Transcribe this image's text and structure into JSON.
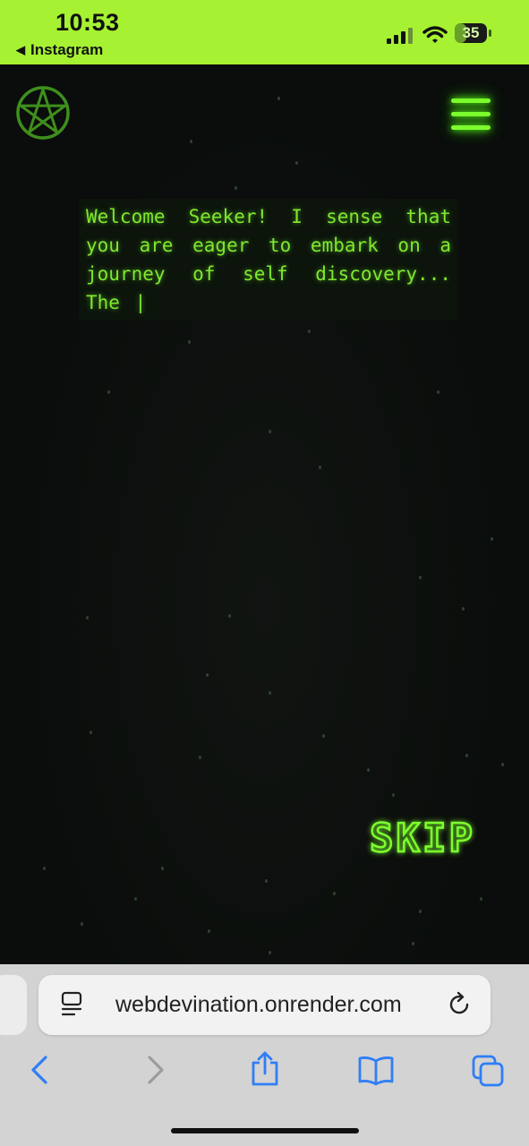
{
  "status_bar": {
    "time": "10:53",
    "back_app": "Instagram",
    "battery": "35",
    "battery_level": 0.35,
    "accent_color": "#a6f232"
  },
  "page": {
    "logo_icon": "pentagram-icon",
    "menu_icon": "hamburger-menu-icon",
    "intro_text": "Welcome Seeker! I sense that you are eager to embark on a journey of self discovery... The",
    "cursor": "|",
    "skip_label": "SKIP",
    "glow_color": "#7dff2e"
  },
  "browser": {
    "url": "webdevination.onrender.com",
    "icons": [
      "page-settings-icon",
      "reload-icon",
      "back-arrow-icon",
      "forward-arrow-icon",
      "share-icon",
      "bookmarks-icon",
      "tabs-icon"
    ]
  }
}
